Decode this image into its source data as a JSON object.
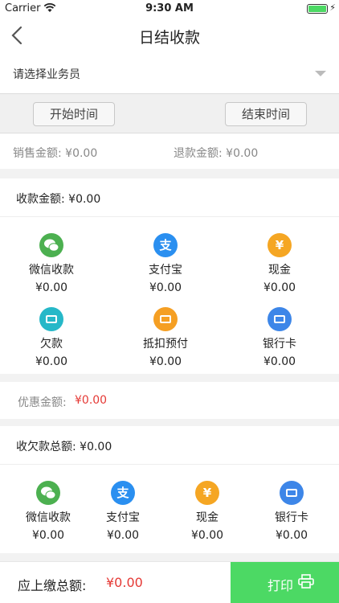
{
  "status_bar": {
    "carrier": "Carrier",
    "time": "9:30 AM"
  },
  "nav": {
    "title": "日结收款"
  },
  "salesperson_select": {
    "placeholder": "请选择业务员"
  },
  "time_range": {
    "start_label": "开始时间",
    "end_label": "结束时间"
  },
  "amounts": {
    "sales": "销售金额: ¥0.00",
    "refund": "退款金额: ¥0.00"
  },
  "collection": {
    "header": "收款金额: ¥0.00",
    "items": [
      {
        "name": "微信收款",
        "value": "¥0.00",
        "icon": "wechat-icon"
      },
      {
        "name": "支付宝",
        "value": "¥0.00",
        "icon": "alipay-icon"
      },
      {
        "name": "现金",
        "value": "¥0.00",
        "icon": "cash-icon"
      },
      {
        "name": "欠款",
        "value": "¥0.00",
        "icon": "debt-icon"
      },
      {
        "name": "抵扣预付",
        "value": "¥0.00",
        "icon": "prepaid-icon"
      },
      {
        "name": "银行卡",
        "value": "¥0.00",
        "icon": "bank-card-icon"
      }
    ]
  },
  "discount": {
    "label": "优惠金额:",
    "value": "¥0.00"
  },
  "debt_collection": {
    "header": "收欠款总额: ¥0.00",
    "items": [
      {
        "name": "微信收款",
        "value": "¥0.00",
        "icon": "wechat-icon"
      },
      {
        "name": "支付宝",
        "value": "¥0.00",
        "icon": "alipay-icon"
      },
      {
        "name": "现金",
        "value": "¥0.00",
        "icon": "cash-icon"
      },
      {
        "name": "银行卡",
        "value": "¥0.00",
        "icon": "bank-card-icon"
      }
    ]
  },
  "footer": {
    "total_label": "应上缴总额:",
    "total_value": "¥0.00",
    "print_label": "打印"
  },
  "colors": {
    "accent_green": "#4cd964",
    "amount_red": "#e53935"
  }
}
